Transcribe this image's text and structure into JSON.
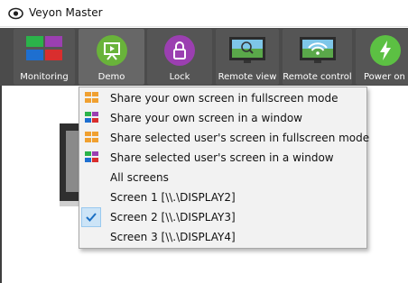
{
  "window": {
    "title": "Veyon Master"
  },
  "toolbar": {
    "buttons": [
      {
        "label": "Monitoring",
        "icon": "monitoring-grid-icon"
      },
      {
        "label": "Demo",
        "icon": "presentation-icon"
      },
      {
        "label": "Lock",
        "icon": "lock-icon"
      },
      {
        "label": "Remote view",
        "icon": "remote-view-monitor-icon"
      },
      {
        "label": "Remote control",
        "icon": "remote-control-wifi-icon"
      },
      {
        "label": "Power on",
        "icon": "power-bolt-icon"
      }
    ]
  },
  "demo_menu": {
    "items": [
      {
        "label": "Share your own screen in fullscreen mode",
        "icon": "fullscreen-demo-icon"
      },
      {
        "label": "Share your own screen in a window",
        "icon": "window-demo-icon"
      },
      {
        "label": "Share selected user's screen in fullscreen mode",
        "icon": "fullscreen-demo-icon"
      },
      {
        "label": "Share selected user's screen in a window",
        "icon": "window-demo-icon"
      },
      {
        "label": "All screens",
        "icon": ""
      },
      {
        "label": "Screen 1 [\\\\.\\DISPLAY2]",
        "icon": ""
      },
      {
        "label": "Screen 2 [\\\\.\\DISPLAY3]",
        "icon": "check-icon",
        "checked": true
      },
      {
        "label": "Screen 3 [\\\\.\\DISPLAY4]",
        "icon": ""
      }
    ]
  },
  "colors": {
    "toolbar_bg": "#4b4b4b",
    "menu_bg": "#f2f2f2",
    "check_highlight": "#cce4f7",
    "check_mark": "#1a6fc4"
  }
}
